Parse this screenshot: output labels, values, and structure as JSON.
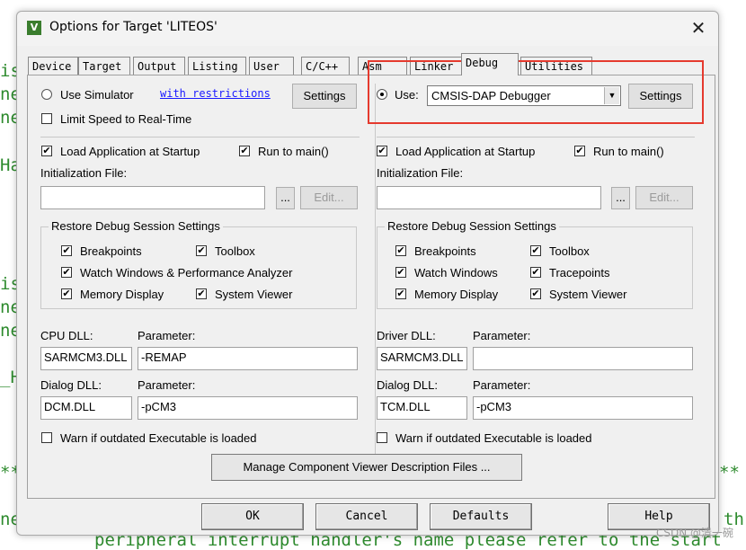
{
  "background_code": {
    "lines": [
      "is",
      "ne",
      "ne",
      "Ha",
      "is",
      "ne",
      "ne",
      "_H",
      "**",
      "**",
      "ne",
      "th",
      "peripheral interrupt handler's name please refer to the start"
    ]
  },
  "dialog": {
    "title": "Options for Target 'LITEOS'",
    "app_icon": "V",
    "close": "✕",
    "tabs": [
      "Device",
      "Target",
      "Output",
      "Listing",
      "User",
      "C/C++",
      "Asm",
      "Linker",
      "Debug",
      "Utilities"
    ],
    "active_tab": "Debug"
  },
  "left": {
    "use_simulator": "Use Simulator",
    "with_restrictions": "with restrictions",
    "settings": "Settings",
    "limit_speed": "Limit Speed to Real-Time",
    "load_app": "Load Application at Startup",
    "run_to_main": "Run to main()",
    "init_file": "Initialization File:",
    "browse": "...",
    "edit": "Edit...",
    "restore_group": "Restore Debug Session Settings",
    "breakpoints": "Breakpoints",
    "toolbox": "Toolbox",
    "watch_windows": "Watch Windows & Performance Analyzer",
    "memory_display": "Memory Display",
    "system_viewer": "System Viewer",
    "cpu_dll_label": "CPU DLL:",
    "param_label": "Parameter:",
    "cpu_dll": "SARMCM3.DLL",
    "cpu_param": "-REMAP",
    "dialog_dll_label": "Dialog DLL:",
    "dialog_dll": "DCM.DLL",
    "dialog_param": "-pCM3",
    "warn": "Warn if outdated Executable is loaded"
  },
  "right": {
    "use": "Use:",
    "debugger": "CMSIS-DAP Debugger",
    "settings": "Settings",
    "load_app": "Load Application at Startup",
    "run_to_main": "Run to main()",
    "init_file": "Initialization File:",
    "browse": "...",
    "edit": "Edit...",
    "restore_group": "Restore Debug Session Settings",
    "breakpoints": "Breakpoints",
    "toolbox": "Toolbox",
    "watch_windows": "Watch Windows",
    "tracepoints": "Tracepoints",
    "memory_display": "Memory Display",
    "system_viewer": "System Viewer",
    "driver_dll_label": "Driver DLL:",
    "param_label": "Parameter:",
    "driver_dll": "SARMCM3.DLL",
    "driver_param": "",
    "dialog_dll_label": "Dialog DLL:",
    "dialog_dll": "TCM.DLL",
    "dialog_param": "-pCM3",
    "warn": "Warn if outdated Executable is loaded"
  },
  "manage_button": "Manage Component Viewer Description Files ...",
  "buttons": {
    "ok": "OK",
    "cancel": "Cancel",
    "defaults": "Defaults",
    "help": "Help"
  },
  "check": "✔",
  "watermark": "CSDN @清一碗",
  "highlight_color": "#e53a2e"
}
